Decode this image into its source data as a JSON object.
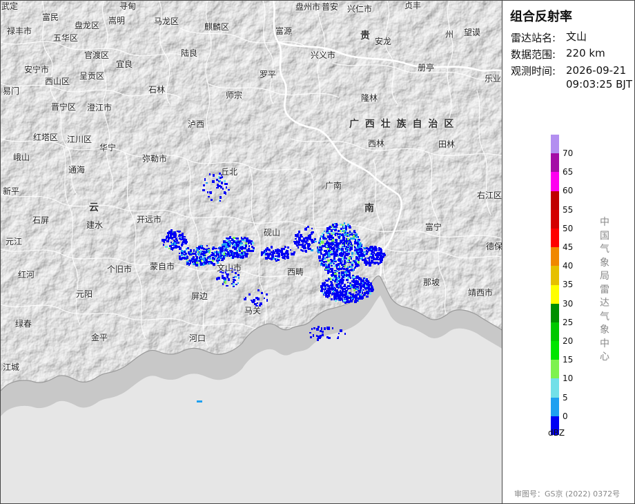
{
  "panel": {
    "title": "组合反射率",
    "station_label": "雷达站名:",
    "station": "文山",
    "range_label": "数据范围:",
    "range": "220 km",
    "time_label": "观测时间:",
    "date": "2026-09-21",
    "time": "09:03:25 BJT",
    "agency": [
      "中",
      "国",
      "气",
      "象",
      "局",
      "雷",
      "达",
      "气",
      "象",
      "中",
      "心"
    ],
    "unit": "dBZ",
    "review_number": "审图号：GS京 (2022) 0372号"
  },
  "legend": {
    "colors": [
      "#b38ff0",
      "#a40da6",
      "#ff00f0",
      "#c00000",
      "#d40000",
      "#ff0000",
      "#f08800",
      "#e6c000",
      "#ffff00",
      "#009000",
      "#00c800",
      "#00e500",
      "#7ef24f",
      "#72e0e8",
      "#1ea0f0",
      "#0000f4"
    ],
    "ticks": [
      "70",
      "65",
      "60",
      "55",
      "50",
      "45",
      "40",
      "35",
      "30",
      "25",
      "20",
      "15",
      "10",
      "5",
      "0"
    ]
  },
  "provinces": [
    {
      "name": "广 西 壮 族 自 治 区"
    },
    {
      "name": "贵"
    },
    {
      "name": "云"
    },
    {
      "name": "南"
    }
  ],
  "places": [
    "武定",
    "富民",
    "嵩明",
    "寻甸",
    "马龙区",
    "麒麟区",
    "盘州市",
    "普安",
    "兴仁市",
    "贞丰",
    "望谟",
    "禄丰市",
    "五华区",
    "盘龙区",
    "富源",
    "安龙",
    "州",
    "官渡区",
    "陆良",
    "兴义市",
    "册亭",
    "乐业",
    "安宁市",
    "呈贡区",
    "宜良",
    "罗平",
    "西山区",
    "易门",
    "石林",
    "师宗",
    "隆林",
    "晋宁区",
    "澄江市",
    "江川区",
    "泸西",
    "西林",
    "田林",
    "峨山",
    "红塔区",
    "华宁",
    "弥勒市",
    "丘北",
    "通海",
    "广南",
    "右江区",
    "新平",
    "开远市",
    "砚山",
    "石屏",
    "建水",
    "富宁",
    "元江",
    "德保",
    "蒙自市",
    "文山市",
    "个旧市",
    "西畴",
    "红河",
    "那坡",
    "元阳",
    "屏边",
    "靖西市",
    "绿春",
    "马关",
    "金平",
    "河口",
    "江城"
  ],
  "radar": {
    "colors_used": [
      "#0000f4",
      "#1ea0f0",
      "#72e0e8",
      "#7ef24f"
    ]
  }
}
